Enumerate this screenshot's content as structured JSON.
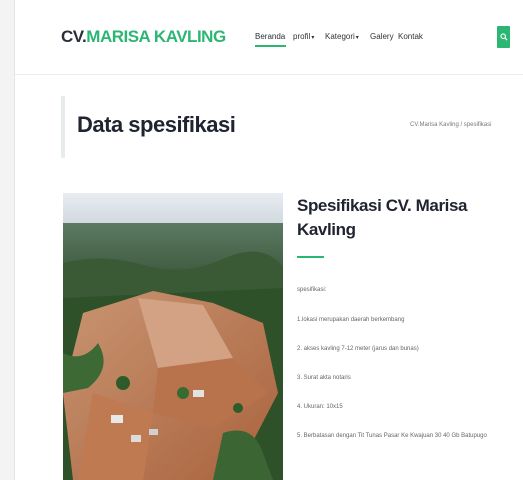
{
  "header": {
    "logo_prefix": "CV.",
    "logo_name": "MARISA KAVLING",
    "nav": [
      {
        "label": "Beranda",
        "active": true,
        "dropdown": false
      },
      {
        "label": "profil",
        "active": false,
        "dropdown": true
      },
      {
        "label": "Kategori",
        "active": false,
        "dropdown": true
      },
      {
        "label": "Galery",
        "active": false,
        "dropdown": false
      },
      {
        "label": "Kontak",
        "active": false,
        "dropdown": false
      }
    ],
    "search_icon": "search-icon"
  },
  "page": {
    "title": "Data spesifikasi",
    "breadcrumb": "CV.Marisa Kavling  /  spesifikasi"
  },
  "spec": {
    "title": "Spesifikasi CV. Marisa Kavling",
    "label": "spesifikasi:",
    "items": [
      "1.lokasi merupakan daerah berkembang",
      "2. akses kavling 7-12 meter (jarus dan bunas)",
      "3. Surat akta notaris",
      "4. Ukuran: 10x15",
      "5. Berbatasan dengan Tit Tunas Pasar Ke Kwajuan 30 40 Gb Batupugo"
    ]
  },
  "colors": {
    "accent": "#2bb673",
    "heading": "#1f2430"
  }
}
